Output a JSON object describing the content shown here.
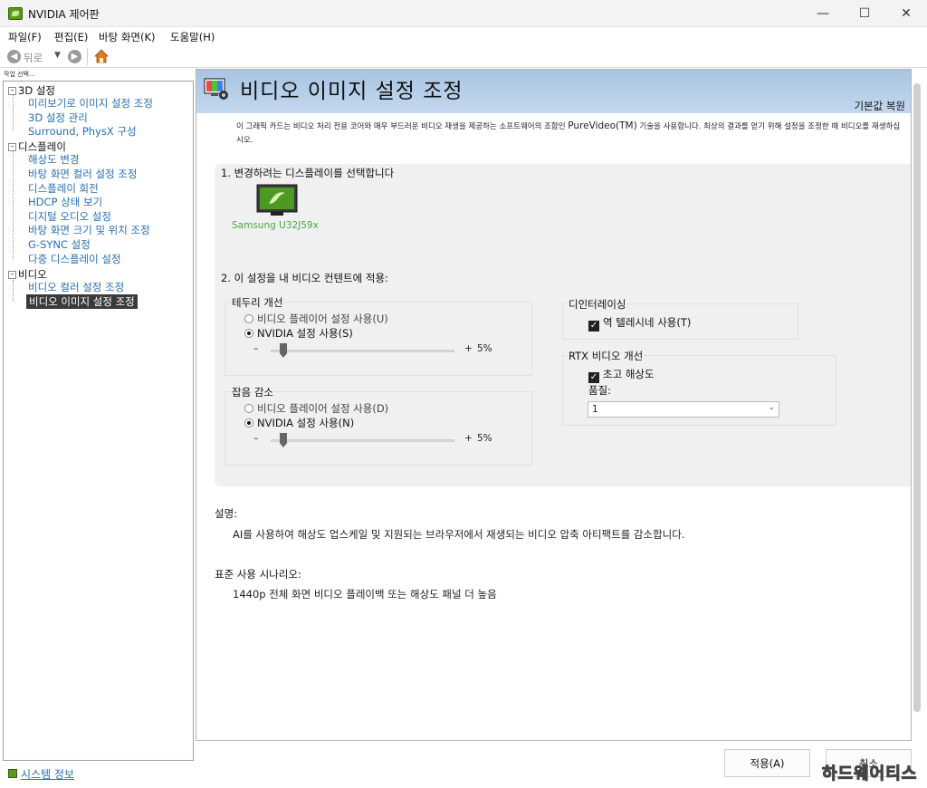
{
  "window": {
    "title": "NVIDIA 제어판",
    "minimize": "—",
    "maximize": "☐",
    "close": "✕"
  },
  "menu": [
    "파일(F)",
    "편집(E)",
    "바탕 화면(K)",
    "도움말(H)"
  ],
  "toolbar": {
    "back_label": "뒤로"
  },
  "sidebar": {
    "task_label": "작업 선택...",
    "categories": [
      {
        "label": "3D 설정",
        "items": [
          "미리보기로 이미지 설정 조정",
          "3D 설정 관리",
          "Surround, PhysX 구성"
        ]
      },
      {
        "label": "디스플레이",
        "items": [
          "해상도 변경",
          "바탕 화면 컬러 설정 조정",
          "디스플레이 회전",
          "HDCP 상태 보기",
          "디지털 오디오 설정",
          "바탕 화면 크기 및 위치 조정",
          "G-SYNC 설정",
          "다중 디스플레이 설정"
        ]
      },
      {
        "label": "비디오",
        "items": [
          "비디오 컬러 설정 조정",
          "비디오 이미지 설정 조정"
        ]
      }
    ],
    "selected_item": "비디오 이미지 설정 조정",
    "system_info": "시스템 정보"
  },
  "page": {
    "title": "비디오 이미지 설정 조정",
    "restore_defaults": "기본값 복원",
    "intro_pre": "이 그래픽 카드는 비디오 처리 전용 코어와 매우 부드러운 비디오 재생을 제공하는 소프트웨어의 조합인",
    "intro_brand": "PureVideo(TM)",
    "intro_post": "기술을 사용합니다. 최상의 결과를 얻기 위해 설정을 조정한 때 비디오를 재생하십시오.",
    "step1": "1. 변경하려는 디스플레이를 선택합니다",
    "display_name": "Samsung U32J59x",
    "step2": "2. 이 설정을 내 비디오 컨텐트에 적용:",
    "edge": {
      "title": "테두리 개선",
      "option1": "비디오 플레이어 설정 사용(U)",
      "option2": "NVIDIA 설정 사용(S)",
      "minus": "–",
      "plus": "+",
      "value": "5%",
      "level": 5
    },
    "noise": {
      "title": "잡음 감소",
      "option1": "비디오 플레이어 설정 사용(D)",
      "option2": "NVIDIA 설정 사용(N)",
      "minus": "–",
      "plus": "+",
      "value": "5%",
      "level": 5
    },
    "deinterlace": {
      "title": "디인터레이싱",
      "check_label": "역 텔레시네 사용(T)"
    },
    "rtx": {
      "title": "RTX 비디오 개선",
      "check_label": "초고 해상도",
      "quality_label": "품질:",
      "quality_value": "1"
    },
    "description_label": "설명:",
    "description_text": "AI를 사용하여 해상도 업스케일 및 지원되는 브라우저에서 재생되는 비디오 압축 아티팩트를 감소합니다.",
    "scenario_label": "표준 사용 시나리오:",
    "scenario_text": "1440p 전체 화면 비디오 플레이백 또는 해상도 패널 더 높음"
  },
  "buttons": {
    "apply": "적용(A)",
    "cancel": "취소"
  },
  "watermark": "하드웨어티스",
  "colors": {
    "accent_link": "#2a6fb0",
    "header_band": "#b6cde8",
    "display_label": "#4aa84a"
  }
}
